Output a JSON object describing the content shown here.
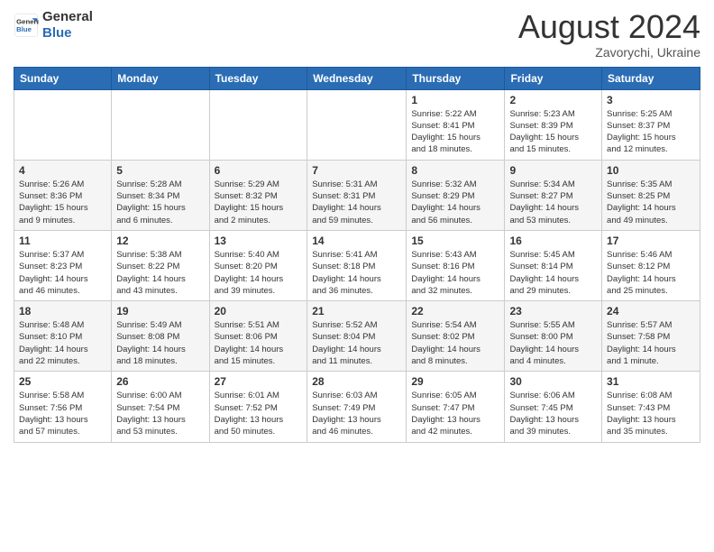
{
  "header": {
    "logo_line1": "General",
    "logo_line2": "Blue",
    "month_year": "August 2024",
    "location": "Zavorychi, Ukraine"
  },
  "weekdays": [
    "Sunday",
    "Monday",
    "Tuesday",
    "Wednesday",
    "Thursday",
    "Friday",
    "Saturday"
  ],
  "weeks": [
    [
      {
        "day": "",
        "info": ""
      },
      {
        "day": "",
        "info": ""
      },
      {
        "day": "",
        "info": ""
      },
      {
        "day": "",
        "info": ""
      },
      {
        "day": "1",
        "info": "Sunrise: 5:22 AM\nSunset: 8:41 PM\nDaylight: 15 hours\nand 18 minutes."
      },
      {
        "day": "2",
        "info": "Sunrise: 5:23 AM\nSunset: 8:39 PM\nDaylight: 15 hours\nand 15 minutes."
      },
      {
        "day": "3",
        "info": "Sunrise: 5:25 AM\nSunset: 8:37 PM\nDaylight: 15 hours\nand 12 minutes."
      }
    ],
    [
      {
        "day": "4",
        "info": "Sunrise: 5:26 AM\nSunset: 8:36 PM\nDaylight: 15 hours\nand 9 minutes."
      },
      {
        "day": "5",
        "info": "Sunrise: 5:28 AM\nSunset: 8:34 PM\nDaylight: 15 hours\nand 6 minutes."
      },
      {
        "day": "6",
        "info": "Sunrise: 5:29 AM\nSunset: 8:32 PM\nDaylight: 15 hours\nand 2 minutes."
      },
      {
        "day": "7",
        "info": "Sunrise: 5:31 AM\nSunset: 8:31 PM\nDaylight: 14 hours\nand 59 minutes."
      },
      {
        "day": "8",
        "info": "Sunrise: 5:32 AM\nSunset: 8:29 PM\nDaylight: 14 hours\nand 56 minutes."
      },
      {
        "day": "9",
        "info": "Sunrise: 5:34 AM\nSunset: 8:27 PM\nDaylight: 14 hours\nand 53 minutes."
      },
      {
        "day": "10",
        "info": "Sunrise: 5:35 AM\nSunset: 8:25 PM\nDaylight: 14 hours\nand 49 minutes."
      }
    ],
    [
      {
        "day": "11",
        "info": "Sunrise: 5:37 AM\nSunset: 8:23 PM\nDaylight: 14 hours\nand 46 minutes."
      },
      {
        "day": "12",
        "info": "Sunrise: 5:38 AM\nSunset: 8:22 PM\nDaylight: 14 hours\nand 43 minutes."
      },
      {
        "day": "13",
        "info": "Sunrise: 5:40 AM\nSunset: 8:20 PM\nDaylight: 14 hours\nand 39 minutes."
      },
      {
        "day": "14",
        "info": "Sunrise: 5:41 AM\nSunset: 8:18 PM\nDaylight: 14 hours\nand 36 minutes."
      },
      {
        "day": "15",
        "info": "Sunrise: 5:43 AM\nSunset: 8:16 PM\nDaylight: 14 hours\nand 32 minutes."
      },
      {
        "day": "16",
        "info": "Sunrise: 5:45 AM\nSunset: 8:14 PM\nDaylight: 14 hours\nand 29 minutes."
      },
      {
        "day": "17",
        "info": "Sunrise: 5:46 AM\nSunset: 8:12 PM\nDaylight: 14 hours\nand 25 minutes."
      }
    ],
    [
      {
        "day": "18",
        "info": "Sunrise: 5:48 AM\nSunset: 8:10 PM\nDaylight: 14 hours\nand 22 minutes."
      },
      {
        "day": "19",
        "info": "Sunrise: 5:49 AM\nSunset: 8:08 PM\nDaylight: 14 hours\nand 18 minutes."
      },
      {
        "day": "20",
        "info": "Sunrise: 5:51 AM\nSunset: 8:06 PM\nDaylight: 14 hours\nand 15 minutes."
      },
      {
        "day": "21",
        "info": "Sunrise: 5:52 AM\nSunset: 8:04 PM\nDaylight: 14 hours\nand 11 minutes."
      },
      {
        "day": "22",
        "info": "Sunrise: 5:54 AM\nSunset: 8:02 PM\nDaylight: 14 hours\nand 8 minutes."
      },
      {
        "day": "23",
        "info": "Sunrise: 5:55 AM\nSunset: 8:00 PM\nDaylight: 14 hours\nand 4 minutes."
      },
      {
        "day": "24",
        "info": "Sunrise: 5:57 AM\nSunset: 7:58 PM\nDaylight: 14 hours\nand 1 minute."
      }
    ],
    [
      {
        "day": "25",
        "info": "Sunrise: 5:58 AM\nSunset: 7:56 PM\nDaylight: 13 hours\nand 57 minutes."
      },
      {
        "day": "26",
        "info": "Sunrise: 6:00 AM\nSunset: 7:54 PM\nDaylight: 13 hours\nand 53 minutes."
      },
      {
        "day": "27",
        "info": "Sunrise: 6:01 AM\nSunset: 7:52 PM\nDaylight: 13 hours\nand 50 minutes."
      },
      {
        "day": "28",
        "info": "Sunrise: 6:03 AM\nSunset: 7:49 PM\nDaylight: 13 hours\nand 46 minutes."
      },
      {
        "day": "29",
        "info": "Sunrise: 6:05 AM\nSunset: 7:47 PM\nDaylight: 13 hours\nand 42 minutes."
      },
      {
        "day": "30",
        "info": "Sunrise: 6:06 AM\nSunset: 7:45 PM\nDaylight: 13 hours\nand 39 minutes."
      },
      {
        "day": "31",
        "info": "Sunrise: 6:08 AM\nSunset: 7:43 PM\nDaylight: 13 hours\nand 35 minutes."
      }
    ]
  ]
}
